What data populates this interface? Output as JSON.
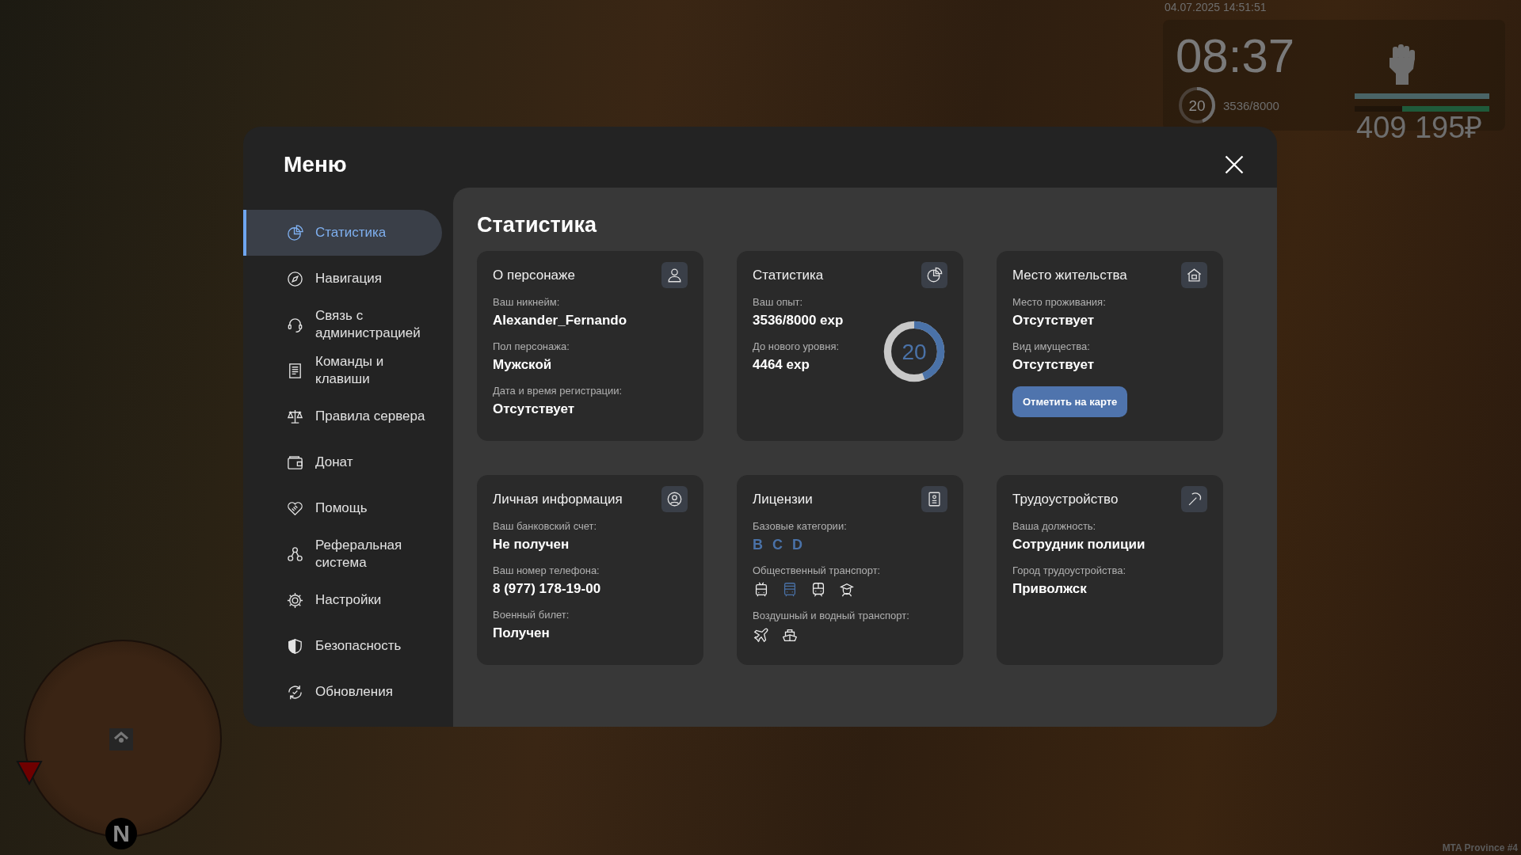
{
  "hud": {
    "datetime": "04.07.2025 14:51:51",
    "clock": "08:37",
    "level_ring": {
      "value": "20",
      "level": 0.442
    },
    "exp": "3536/8000",
    "bars": [
      {
        "level": 1.0,
        "color": "#4a6466"
      },
      {
        "level": 0.65,
        "color": "#1f5a3a"
      }
    ],
    "money": "409 195₽"
  },
  "minimap": {
    "north": "N"
  },
  "server_label": "MTA Province #4",
  "menu": {
    "title": "Меню",
    "sidebar": {
      "items": [
        {
          "label": "Статистика",
          "selected": true
        },
        {
          "label": "Навигация",
          "selected": false
        },
        {
          "label": "Связь с администрацией",
          "selected": false
        },
        {
          "label": "Команды и клавиши",
          "selected": false
        },
        {
          "label": "Правила сервера",
          "selected": false
        },
        {
          "label": "Донат",
          "selected": false
        },
        {
          "label": "Помощь",
          "selected": false
        },
        {
          "label": "Реферальная система",
          "selected": false
        },
        {
          "label": "Настройки",
          "selected": false
        },
        {
          "label": "Безопасность",
          "selected": false
        },
        {
          "label": "Обновления",
          "selected": false
        }
      ]
    },
    "content": {
      "title": "Статистика",
      "cards": [
        {
          "kind": "fields",
          "title": "О персонаже",
          "fields": [
            {
              "label": "Ваш никнейм:",
              "value": "Alexander_Fernando"
            },
            {
              "label": "Пол персонажа:",
              "value": "Мужской"
            },
            {
              "label": "Дата и время регистрации:",
              "value": "Отсутствует"
            }
          ]
        },
        {
          "kind": "progress",
          "title": "Статистика",
          "fields": [
            {
              "label": "Ваш опыт:",
              "value": "3536/8000 exp"
            },
            {
              "label": "До нового уровня:",
              "value": "4464 exp"
            }
          ],
          "ring": {
            "value": "20",
            "level": 0.442
          }
        },
        {
          "kind": "fields",
          "title": "Место жительства",
          "fields": [
            {
              "label": "Место проживания:",
              "value": "Отсутствует"
            },
            {
              "label": "Вид имущества:",
              "value": "Отсутствует"
            }
          ],
          "button": "Отметить на карте"
        },
        {
          "kind": "fields",
          "title": "Личная информация",
          "fields": [
            {
              "label": "Ваш банковский счет:",
              "value": "Не получен"
            },
            {
              "label": "Ваш номер телефона:",
              "value": "8 (977) 178-19-00"
            },
            {
              "label": "Военный билет:",
              "value": "Получен"
            }
          ]
        },
        {
          "kind": "licenses",
          "title": "Лицензии",
          "categories_label": "Базовые категории:",
          "categories": [
            {
              "label": "B",
              "owned": true
            },
            {
              "label": "C",
              "owned": true
            },
            {
              "label": "D",
              "owned": true
            }
          ],
          "public_label": "Общественный транспорт:",
          "public": [
            {
              "owned": false
            },
            {
              "owned": true
            },
            {
              "owned": false
            },
            {
              "owned": false
            }
          ],
          "air_label": "Воздушный и водный транспорт:",
          "air": [
            {
              "owned": false
            },
            {
              "owned": false
            }
          ]
        },
        {
          "kind": "fields",
          "title": "Трудоустройство",
          "fields": [
            {
              "label": "Ваша должность:",
              "value": "Сотрудник полиции"
            },
            {
              "label": "Город трудоустройства:",
              "value": "Приволжск"
            }
          ]
        }
      ]
    }
  }
}
